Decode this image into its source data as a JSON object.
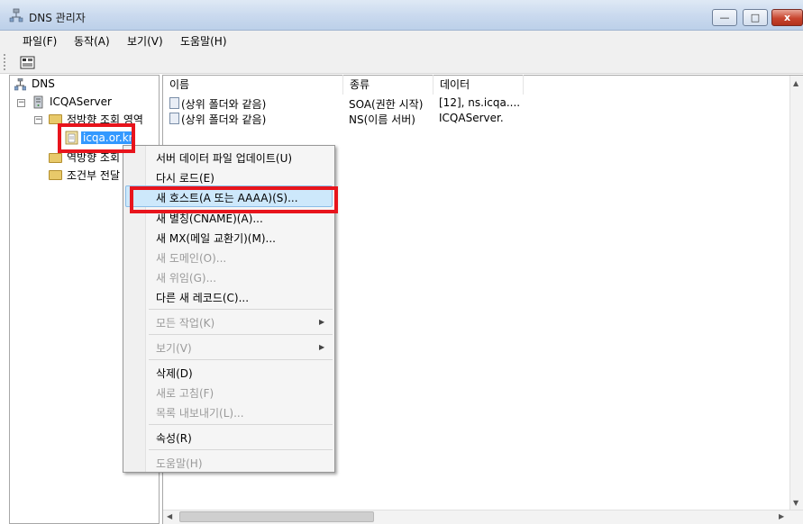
{
  "window": {
    "title": "DNS 관리자",
    "min_glyph": "—",
    "max_glyph": "□",
    "close_glyph": "x"
  },
  "menubar": {
    "items": [
      "파일(F)",
      "동작(A)",
      "보기(V)",
      "도움말(H)"
    ]
  },
  "tree": {
    "root": "DNS",
    "server": "ICQAServer",
    "forward_zone": "정방향 조회 영역",
    "selected_zone": "icqa.or.kr",
    "reverse_zone": "역방향 조회",
    "conditional": "조건부 전달"
  },
  "list": {
    "columns": [
      "이름",
      "종류",
      "데이터"
    ],
    "rows": [
      {
        "name": "(상위 폴더와 같음)",
        "type": "SOA(권한 시작)",
        "data": "[12], ns.icqa...."
      },
      {
        "name": "(상위 폴더와 같음)",
        "type": "NS(이름 서버)",
        "data": "ICQAServer."
      }
    ]
  },
  "context_menu": {
    "items": [
      "서버 데이터 파일 업데이트(U)",
      "다시 로드(E)",
      "새 호스트(A 또는 AAAA)(S)...",
      "새 별칭(CNAME)(A)...",
      "새 MX(메일 교환기)(M)...",
      "새 도메인(O)...",
      "새 위임(G)...",
      "다른 새 레코드(C)...",
      "모든 작업(K)",
      "보기(V)",
      "삭제(D)",
      "새로 고침(F)",
      "목록 내보내기(L)...",
      "속성(R)",
      "도움말(H)"
    ]
  },
  "colors": {
    "highlight_red": "#e8141c",
    "menu_hover": "#cde8fb",
    "selection": "#3399ff"
  }
}
